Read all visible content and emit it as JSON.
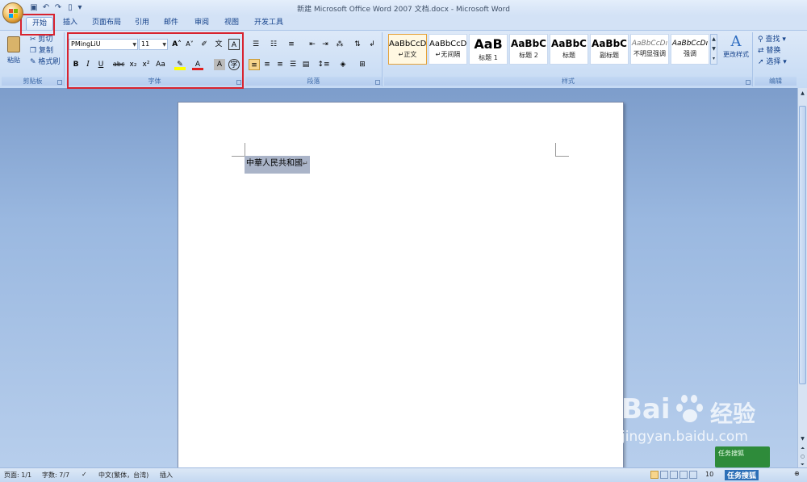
{
  "window": {
    "title": "新建 Microsoft Office Word 2007 文档.docx - Microsoft Word"
  },
  "tabs": [
    "开始",
    "插入",
    "页面布局",
    "引用",
    "邮件",
    "审阅",
    "视图",
    "开发工具"
  ],
  "clipboard": {
    "paste": "粘贴",
    "cut": "剪切",
    "copy": "复制",
    "format_painter": "格式刷",
    "label": "剪贴板"
  },
  "font": {
    "name": "PMingLiU",
    "size": "11",
    "label": "字体"
  },
  "paragraph": {
    "label": "段落"
  },
  "styles": {
    "items": [
      {
        "sample": "AaBbCcD",
        "name": "↵正文"
      },
      {
        "sample": "AaBbCcD",
        "name": "↵无间隔"
      },
      {
        "sample": "AaB",
        "name": "标题 1"
      },
      {
        "sample": "AaBbC",
        "name": "标题 2"
      },
      {
        "sample": "AaBbC",
        "name": "标题"
      },
      {
        "sample": "AaBbC",
        "name": "副标题"
      },
      {
        "sample": "AaBbCcDı",
        "name": "不明显强调"
      },
      {
        "sample": "AaBbCcDı",
        "name": "强调"
      }
    ],
    "change_styles": "更改样式",
    "label": "样式"
  },
  "editing": {
    "find": "查找",
    "replace": "替换",
    "select": "选择",
    "label": "编辑"
  },
  "document": {
    "text": "中華人民共和國"
  },
  "statusbar": {
    "page": "页面: 1/1",
    "words": "字数: 7/7",
    "language": "中文(繁体，台湾)",
    "mode": "插入",
    "zoom": "10"
  },
  "watermark": {
    "brand": "Bai",
    "brand2": "经验",
    "url": "jingyan.baidu.com",
    "badge_top": "任务搜狐",
    "badge_bottom": "任务搜狐"
  },
  "colors": {
    "highlight": "#d8232f",
    "accent": "#15428b"
  }
}
